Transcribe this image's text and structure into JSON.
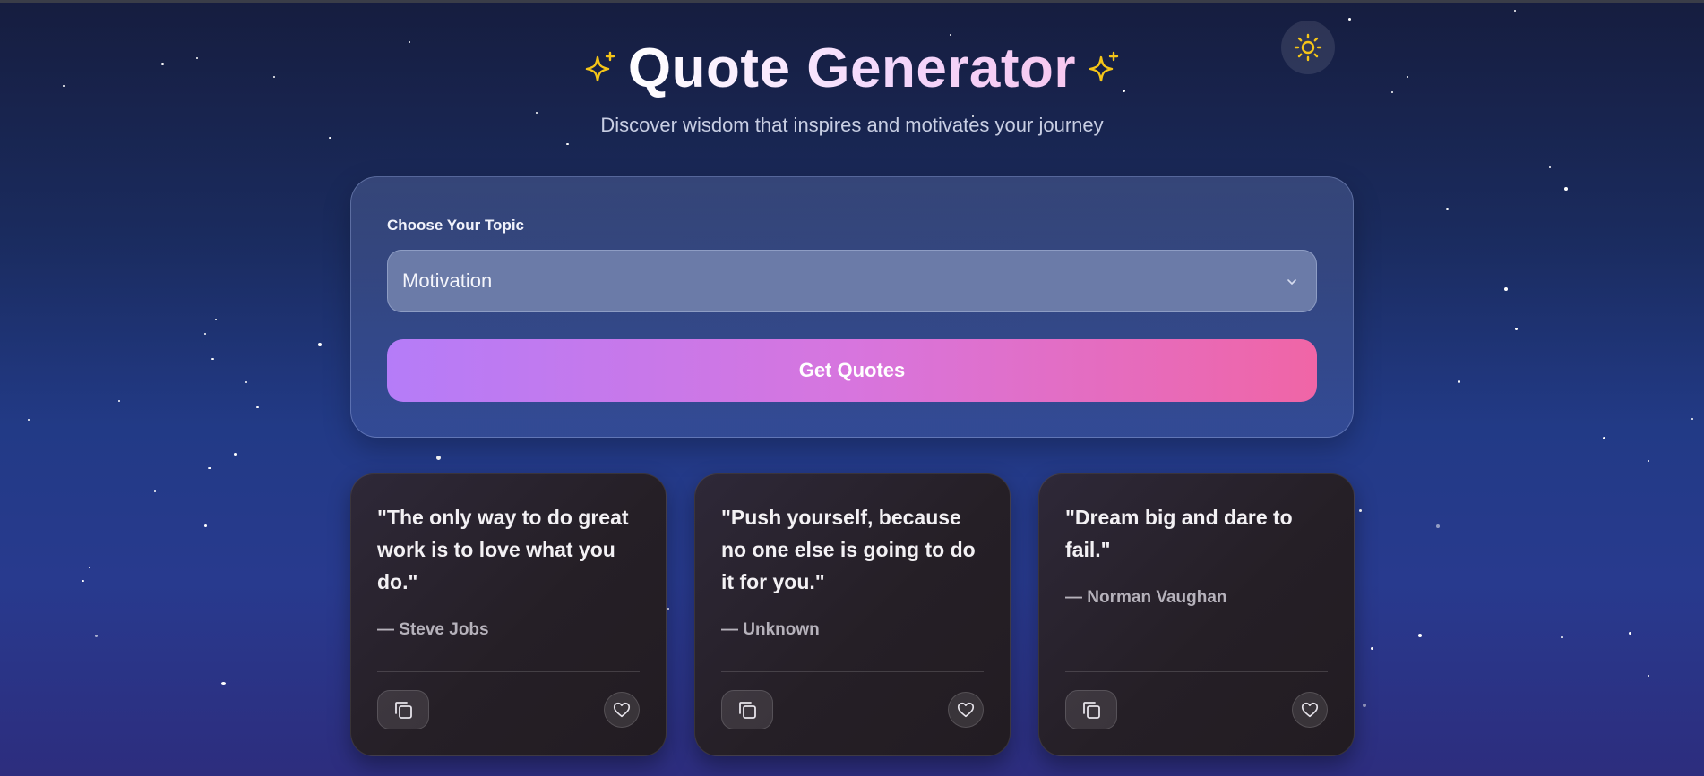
{
  "header": {
    "title": "Quote Generator",
    "subtitle": "Discover wisdom that inspires and motivates your journey"
  },
  "icons": {
    "theme_toggle": "sun-icon",
    "title_decoration": "sparkle-icon",
    "copy": "copy-icon",
    "favorite": "heart-icon",
    "select_arrow": "chevron-down-icon"
  },
  "form": {
    "topic_label": "Choose Your Topic",
    "topic_value": "Motivation",
    "submit_label": "Get Quotes"
  },
  "quotes": [
    {
      "text": "\"The only way to do great work is to love what you do.\"",
      "author": "— Steve Jobs"
    },
    {
      "text": "\"Push yourself, because no one else is going to do it for you.\"",
      "author": "— Unknown"
    },
    {
      "text": "\"Dream big and dare to fail.\"",
      "author": "— Norman Vaughan"
    }
  ],
  "colors": {
    "accent_start": "#b57cf8",
    "accent_end": "#f065a6",
    "sparkle": "#f5c518",
    "background_top": "#161d3f",
    "background_bottom": "#2d2d7e"
  }
}
